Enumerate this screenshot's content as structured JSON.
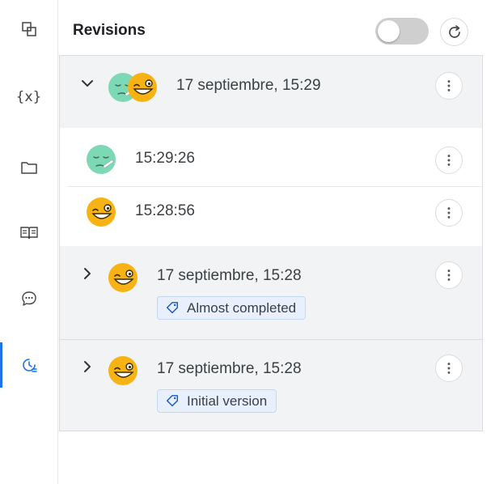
{
  "sidebar": {
    "items": [
      {
        "name": "overlap-squares-icon",
        "active": false
      },
      {
        "name": "variables-icon",
        "glyph": "{x}",
        "active": false
      },
      {
        "name": "folder-icon",
        "active": false
      },
      {
        "name": "book-icon",
        "active": false
      },
      {
        "name": "chat-bubble-icon",
        "active": false
      },
      {
        "name": "history-icon",
        "active": true
      }
    ]
  },
  "panel": {
    "title": "Revisions",
    "toggle_on": false
  },
  "revisions": [
    {
      "date": "17 septiembre, 15:29",
      "expanded": true,
      "authors": [
        "sick-face-avatar",
        "grin-face-avatar"
      ],
      "subitems": [
        {
          "time": "15:29:26",
          "author": "sick-face-avatar"
        },
        {
          "time": "15:28:56",
          "author": "grin-face-avatar"
        }
      ]
    },
    {
      "date": "17 septiembre, 15:28",
      "expanded": false,
      "authors": [
        "grin-face-avatar"
      ],
      "tag": "Almost completed"
    },
    {
      "date": "17 septiembre, 15:28",
      "expanded": false,
      "authors": [
        "grin-face-avatar"
      ],
      "tag": "Initial version"
    }
  ],
  "colors": {
    "accent": "#1a73e8",
    "sick_avatar": "#7dd8b5",
    "grin_avatar": "#f7b314",
    "group_bg": "#f1f3f4",
    "tag_bg": "#e8f0fe"
  }
}
